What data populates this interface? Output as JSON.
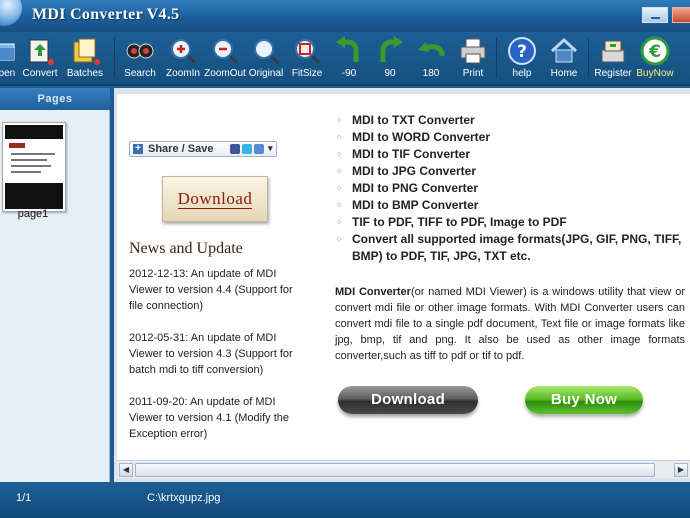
{
  "window": {
    "title": "MDI Converter V4.5"
  },
  "toolbar": {
    "open": "Open",
    "convert": "Convert",
    "batches": "Batches",
    "search": "Search",
    "zoomin": "ZoomIn",
    "zoomout": "ZoomOut",
    "original": "Original",
    "fitsize": "FitSize",
    "rotate_left": "-90",
    "rotate_right": "90",
    "rotate_180": "180",
    "print": "Print",
    "help": "help",
    "home": "Home",
    "register": "Register",
    "buynow": "BuyNow"
  },
  "pages_panel": {
    "header": "Pages",
    "thumbnails": [
      {
        "label": "page1"
      }
    ]
  },
  "content": {
    "share_label": "Share / Save",
    "download_button": "Download",
    "news_title": "News and Update",
    "news": [
      "2012-12-13: An update of MDI Viewer to version 4.4 (Support for file connection)",
      "2012-05-31: An update of MDI Viewer to version 4.3 (Support for batch mdi to tiff conversion)",
      "2011-09-20: An update of MDI Viewer to version 4.1 (Modify the Exception error)"
    ],
    "features": [
      "MDI to TXT Converter",
      "MDI to WORD Converter",
      "MDI to TIF Converter",
      "MDI to JPG Converter",
      "MDI to PNG Converter",
      "MDI to BMP Converter",
      "TIF to PDF, TIFF to PDF, Image to PDF",
      "Convert all supported image formats(JPG, GIF, PNG, TIFF, BMP) to PDF, TIF, JPG, TXT etc."
    ],
    "description_lead": "MDI Converter",
    "description_body": "(or named MDI Viewer) is a windows utility that view or convert mdi file or other image formats. With MDI Converter users can convert mdi file to a single pdf document, Text file or image formats like jpg, bmp, tif and png. It also be used as other image formats converter,such as tiff to pdf or tif to pdf.",
    "download_pill": "Download",
    "buynow_pill": "Buy Now"
  },
  "status": {
    "page_counter": "1/1",
    "file_path": "C:\\krtxgupz.jpg"
  },
  "colors": {
    "titlebar": "#1c5f9a",
    "toolbar": "#16507f",
    "panel_bg": "#e6eef7",
    "buy_label": "#f6f27a",
    "download_text": "#8a1a0c"
  },
  "icons": [
    "app-globe-icon",
    "open-icon",
    "convert-icon",
    "batches-icon",
    "search-icon",
    "zoom-in-icon",
    "zoom-out-icon",
    "original-icon",
    "fit-size-icon",
    "rotate-left-icon",
    "rotate-right-icon",
    "rotate-180-icon",
    "print-icon",
    "help-icon",
    "home-icon",
    "register-icon",
    "buy-now-icon"
  ]
}
